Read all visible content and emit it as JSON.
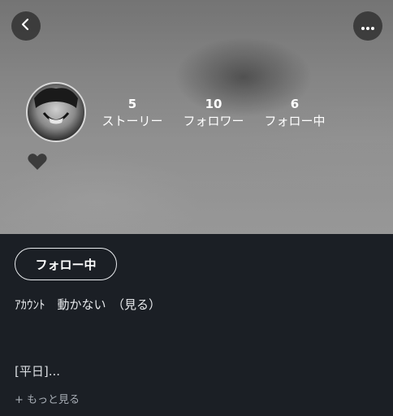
{
  "header": {
    "back_icon": "chevron-left-icon",
    "more_icon": "more-horizontal-icon"
  },
  "stats": [
    {
      "value": "5",
      "label": "ストーリー"
    },
    {
      "value": "10",
      "label": "フォロワー"
    },
    {
      "value": "6",
      "label": "フォロー中"
    }
  ],
  "heart_icon": "heart-icon",
  "follow_button_label": "フォロー中",
  "profile": {
    "account_text": "ｱｶｳﾝﾄ　動かない　（見る）",
    "bio_preview": "[平日]...",
    "more_link": "+ もっと見る"
  },
  "colors": {
    "background": "#1b1f25",
    "text": "#ffffff",
    "muted": "#a7adb5"
  }
}
